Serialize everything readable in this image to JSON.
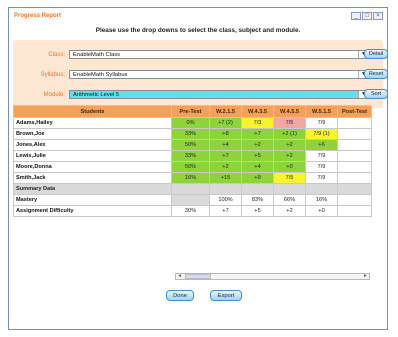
{
  "window": {
    "title": "Progress Report",
    "buttons": [
      "_",
      "□",
      "×"
    ]
  },
  "instruction": "Please use the drop downs to select the class, subject and module.",
  "filters": {
    "class_label": "Class:",
    "class_value": "EnableMath Class",
    "syllabus_label": "Syllabus:",
    "syllabus_value": "EnableMath Syllabus",
    "module_label": "Module:",
    "module_value": "Arithmetic Level 5"
  },
  "side_buttons": {
    "detail": "Detail",
    "reset": "Reset",
    "sort": "Sort"
  },
  "table": {
    "headers": [
      "Students",
      "Pre-Test",
      "W.2.1.5",
      "W.4.3.5",
      "W.4.5.5",
      "W.5.1.5",
      "Post-Test"
    ],
    "rows": [
      {
        "name": "Adams,Hailey",
        "cells": [
          "0%",
          "+7 (2)",
          "7/3",
          "7/5",
          "7/9",
          ""
        ]
      },
      {
        "name": "Brown,Joe",
        "cells": [
          "33%",
          "+8",
          "+7",
          "+2 (1)",
          "7/9 (1)",
          ""
        ]
      },
      {
        "name": "Jones,Alex",
        "cells": [
          "50%",
          "+4",
          "+2",
          "+2",
          "+6",
          ""
        ]
      },
      {
        "name": "Lewis,Julie",
        "cells": [
          "33%",
          "+7",
          "+5",
          "+2",
          "7/9",
          ""
        ]
      },
      {
        "name": "Moore,Donna",
        "cells": [
          "50%",
          "+2",
          "+4",
          "+0",
          "7/9",
          ""
        ]
      },
      {
        "name": "Smith,Jack",
        "cells": [
          "16%",
          "+15",
          "+9",
          "7/5",
          "7/9",
          ""
        ]
      }
    ],
    "summary_label": "Summary Data",
    "mastery": {
      "name": "Mastery",
      "cells": [
        "",
        "100%",
        "83%",
        "66%",
        "16%",
        ""
      ]
    },
    "difficulty": {
      "name": "Assignment Difficulty",
      "cells": [
        "30%",
        "+7",
        "+5",
        "+2",
        "+0",
        ""
      ]
    }
  },
  "scrollbar": {
    "left_arrow": "◄",
    "right_arrow": "►"
  },
  "footer": {
    "done": "Done",
    "export": "Export"
  },
  "colors": {
    "accent": "#e8762a",
    "header_bg": "#f2a15c",
    "pass": "#8ed33a",
    "warn": "#f7f32e",
    "fail": "#f4a5a5",
    "module_bg": "#5ee0f0"
  }
}
